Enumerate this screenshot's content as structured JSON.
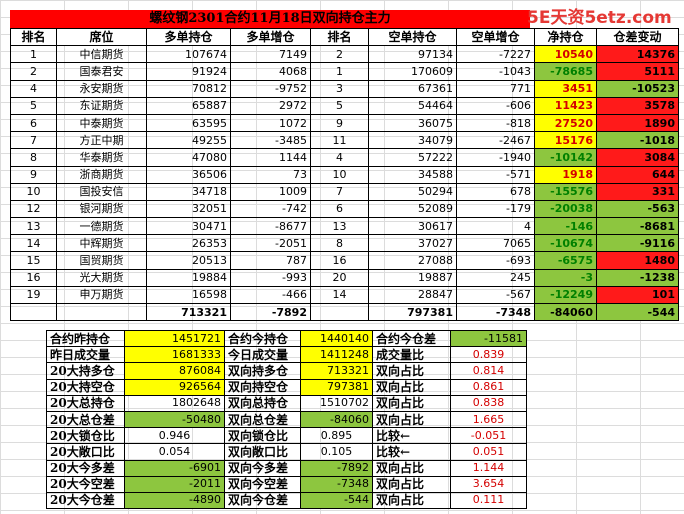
{
  "title": "螺纹钢2301合约11月18日双向持仓主力",
  "watermark": "5E天资5etz.com",
  "colors": {
    "yellow": "#ffff00",
    "green": "#8dc63f",
    "red": "#ff1a1a",
    "red_text": "#d40000",
    "green_text": "#008000"
  },
  "headers": [
    "排名",
    "席位",
    "多单持仓",
    "多单增仓",
    "排名",
    "空单持仓",
    "空单增仓",
    "净持仓",
    "仓差变动"
  ],
  "rows": [
    {
      "rank": "1",
      "seat": "中信期货",
      "long": "107674",
      "long_chg": "7149",
      "srank": "2",
      "short": "97134",
      "short_chg": "-7227",
      "net": "10540",
      "diff": "14376",
      "net_bg": "yel",
      "net_fg": "tr",
      "diff_bg": "red"
    },
    {
      "rank": "2",
      "seat": "国泰君安",
      "long": "91924",
      "long_chg": "4068",
      "srank": "1",
      "short": "170609",
      "short_chg": "-1043",
      "net": "-78685",
      "diff": "5111",
      "net_bg": "grn",
      "net_fg": "tg",
      "diff_bg": "red"
    },
    {
      "rank": "4",
      "seat": "永安期货",
      "long": "70812",
      "long_chg": "-9752",
      "srank": "3",
      "short": "67361",
      "short_chg": "771",
      "net": "3451",
      "diff": "-10523",
      "net_bg": "yel",
      "net_fg": "tr",
      "diff_bg": "grn"
    },
    {
      "rank": "5",
      "seat": "东证期货",
      "long": "65887",
      "long_chg": "2972",
      "srank": "5",
      "short": "54464",
      "short_chg": "-606",
      "net": "11423",
      "diff": "3578",
      "net_bg": "yel",
      "net_fg": "tr",
      "diff_bg": "red"
    },
    {
      "rank": "6",
      "seat": "中泰期货",
      "long": "63595",
      "long_chg": "1072",
      "srank": "9",
      "short": "36075",
      "short_chg": "-818",
      "net": "27520",
      "diff": "1890",
      "net_bg": "yel",
      "net_fg": "tr",
      "diff_bg": "red"
    },
    {
      "rank": "7",
      "seat": "方正中期",
      "long": "49255",
      "long_chg": "-3485",
      "srank": "11",
      "short": "34079",
      "short_chg": "-2467",
      "net": "15176",
      "diff": "-1018",
      "net_bg": "yel",
      "net_fg": "tr",
      "diff_bg": "grn"
    },
    {
      "rank": "8",
      "seat": "华泰期货",
      "long": "47080",
      "long_chg": "1144",
      "srank": "4",
      "short": "57222",
      "short_chg": "-1940",
      "net": "-10142",
      "diff": "3084",
      "net_bg": "grn",
      "net_fg": "tg",
      "diff_bg": "red"
    },
    {
      "rank": "9",
      "seat": "浙商期货",
      "long": "36506",
      "long_chg": "73",
      "srank": "10",
      "short": "34588",
      "short_chg": "-571",
      "net": "1918",
      "diff": "644",
      "net_bg": "yel",
      "net_fg": "tr",
      "diff_bg": "red"
    },
    {
      "rank": "10",
      "seat": "国投安信",
      "long": "34718",
      "long_chg": "1009",
      "srank": "7",
      "short": "50294",
      "short_chg": "678",
      "net": "-15576",
      "diff": "331",
      "net_bg": "grn",
      "net_fg": "tg",
      "diff_bg": "red"
    },
    {
      "rank": "12",
      "seat": "银河期货",
      "long": "32051",
      "long_chg": "-742",
      "srank": "6",
      "short": "52089",
      "short_chg": "-179",
      "net": "-20038",
      "diff": "-563",
      "net_bg": "grn",
      "net_fg": "tg",
      "diff_bg": "grn"
    },
    {
      "rank": "13",
      "seat": "一德期货",
      "long": "30471",
      "long_chg": "-8677",
      "srank": "13",
      "short": "30617",
      "short_chg": "4",
      "net": "-146",
      "diff": "-8681",
      "net_bg": "grn",
      "net_fg": "tg",
      "diff_bg": "grn"
    },
    {
      "rank": "14",
      "seat": "中辉期货",
      "long": "26353",
      "long_chg": "-2051",
      "srank": "8",
      "short": "37027",
      "short_chg": "7065",
      "net": "-10674",
      "diff": "-9116",
      "net_bg": "grn",
      "net_fg": "tg",
      "diff_bg": "grn"
    },
    {
      "rank": "15",
      "seat": "国贸期货",
      "long": "20513",
      "long_chg": "787",
      "srank": "16",
      "short": "27088",
      "short_chg": "-693",
      "net": "-6575",
      "diff": "1480",
      "net_bg": "grn",
      "net_fg": "tg",
      "diff_bg": "red"
    },
    {
      "rank": "16",
      "seat": "光大期货",
      "long": "19884",
      "long_chg": "-993",
      "srank": "20",
      "short": "19887",
      "short_chg": "245",
      "net": "-3",
      "diff": "-1238",
      "net_bg": "grn",
      "net_fg": "tg",
      "diff_bg": "grn"
    },
    {
      "rank": "19",
      "seat": "申万期货",
      "long": "16598",
      "long_chg": "-466",
      "srank": "14",
      "short": "28847",
      "short_chg": "-567",
      "net": "-12249",
      "diff": "101",
      "net_bg": "grn",
      "net_fg": "tg",
      "diff_bg": "red"
    }
  ],
  "totals": {
    "long": "713321",
    "long_chg": "-7892",
    "short": "797381",
    "short_chg": "-7348",
    "net": "-84060",
    "diff": "-544"
  },
  "summary": [
    [
      {
        "t": "合约昨持仓"
      },
      {
        "t": "1451721",
        "bg": "yel"
      },
      {
        "t": "合约今持仓"
      },
      {
        "t": "1440140",
        "bg": "yel"
      },
      {
        "t": "合约今仓差"
      },
      {
        "t": "-11581",
        "bg": "grn"
      }
    ],
    [
      {
        "t": "昨日成交量"
      },
      {
        "t": "1681333",
        "bg": "yel"
      },
      {
        "t": "今日成交量"
      },
      {
        "t": "1411248",
        "bg": "yel"
      },
      {
        "t": "成交量比"
      },
      {
        "t": "0.839",
        "pct": true
      }
    ],
    [
      {
        "t": "20大持多仓"
      },
      {
        "t": "876084",
        "bg": "yel"
      },
      {
        "t": "双向持多仓"
      },
      {
        "t": "713321",
        "bg": "yel"
      },
      {
        "t": "双向占比"
      },
      {
        "t": "0.814",
        "pct": true
      }
    ],
    [
      {
        "t": "20大持空仓"
      },
      {
        "t": "926564",
        "bg": "yel"
      },
      {
        "t": "双向持空仓"
      },
      {
        "t": "797381",
        "bg": "yel"
      },
      {
        "t": "双向占比"
      },
      {
        "t": "0.861",
        "pct": true
      }
    ],
    [
      {
        "t": "20大总持仓"
      },
      {
        "t": "1802648"
      },
      {
        "t": "双向总持仓"
      },
      {
        "t": "1510702"
      },
      {
        "t": "双向占比"
      },
      {
        "t": "0.838",
        "pct": true
      }
    ],
    [
      {
        "t": "20大总仓差"
      },
      {
        "t": "-50480",
        "bg": "grn"
      },
      {
        "t": "双向总仓差"
      },
      {
        "t": "-84060",
        "bg": "grn"
      },
      {
        "t": "双向占比"
      },
      {
        "t": "1.665",
        "pct": true
      }
    ],
    [
      {
        "t": "20大锁仓比"
      },
      {
        "t": "0.946",
        "center": true
      },
      {
        "t": "双向锁仓比"
      },
      {
        "t": "0.895",
        "center": true
      },
      {
        "t": "比较←"
      },
      {
        "t": "-0.051",
        "pct": true
      }
    ],
    [
      {
        "t": "20大敞口比"
      },
      {
        "t": "0.054",
        "center": true
      },
      {
        "t": "双向敞口比"
      },
      {
        "t": "0.105",
        "center": true
      },
      {
        "t": "比较←"
      },
      {
        "t": "0.051",
        "pct": true
      }
    ],
    [
      {
        "t": "20大今多差"
      },
      {
        "t": "-6901",
        "bg": "grn"
      },
      {
        "t": "双向今多差"
      },
      {
        "t": "-7892",
        "bg": "grn"
      },
      {
        "t": "双向占比"
      },
      {
        "t": "1.144",
        "pct": true
      }
    ],
    [
      {
        "t": "20大今空差"
      },
      {
        "t": "-2011",
        "bg": "grn"
      },
      {
        "t": "双向今空差"
      },
      {
        "t": "-7348",
        "bg": "grn"
      },
      {
        "t": "双向占比"
      },
      {
        "t": "3.654",
        "pct": true
      }
    ],
    [
      {
        "t": "20大今仓差"
      },
      {
        "t": "-4890",
        "bg": "grn"
      },
      {
        "t": "双向今仓差"
      },
      {
        "t": "-544",
        "bg": "grn"
      },
      {
        "t": "双向占比"
      },
      {
        "t": "0.111",
        "pct": true
      }
    ]
  ]
}
